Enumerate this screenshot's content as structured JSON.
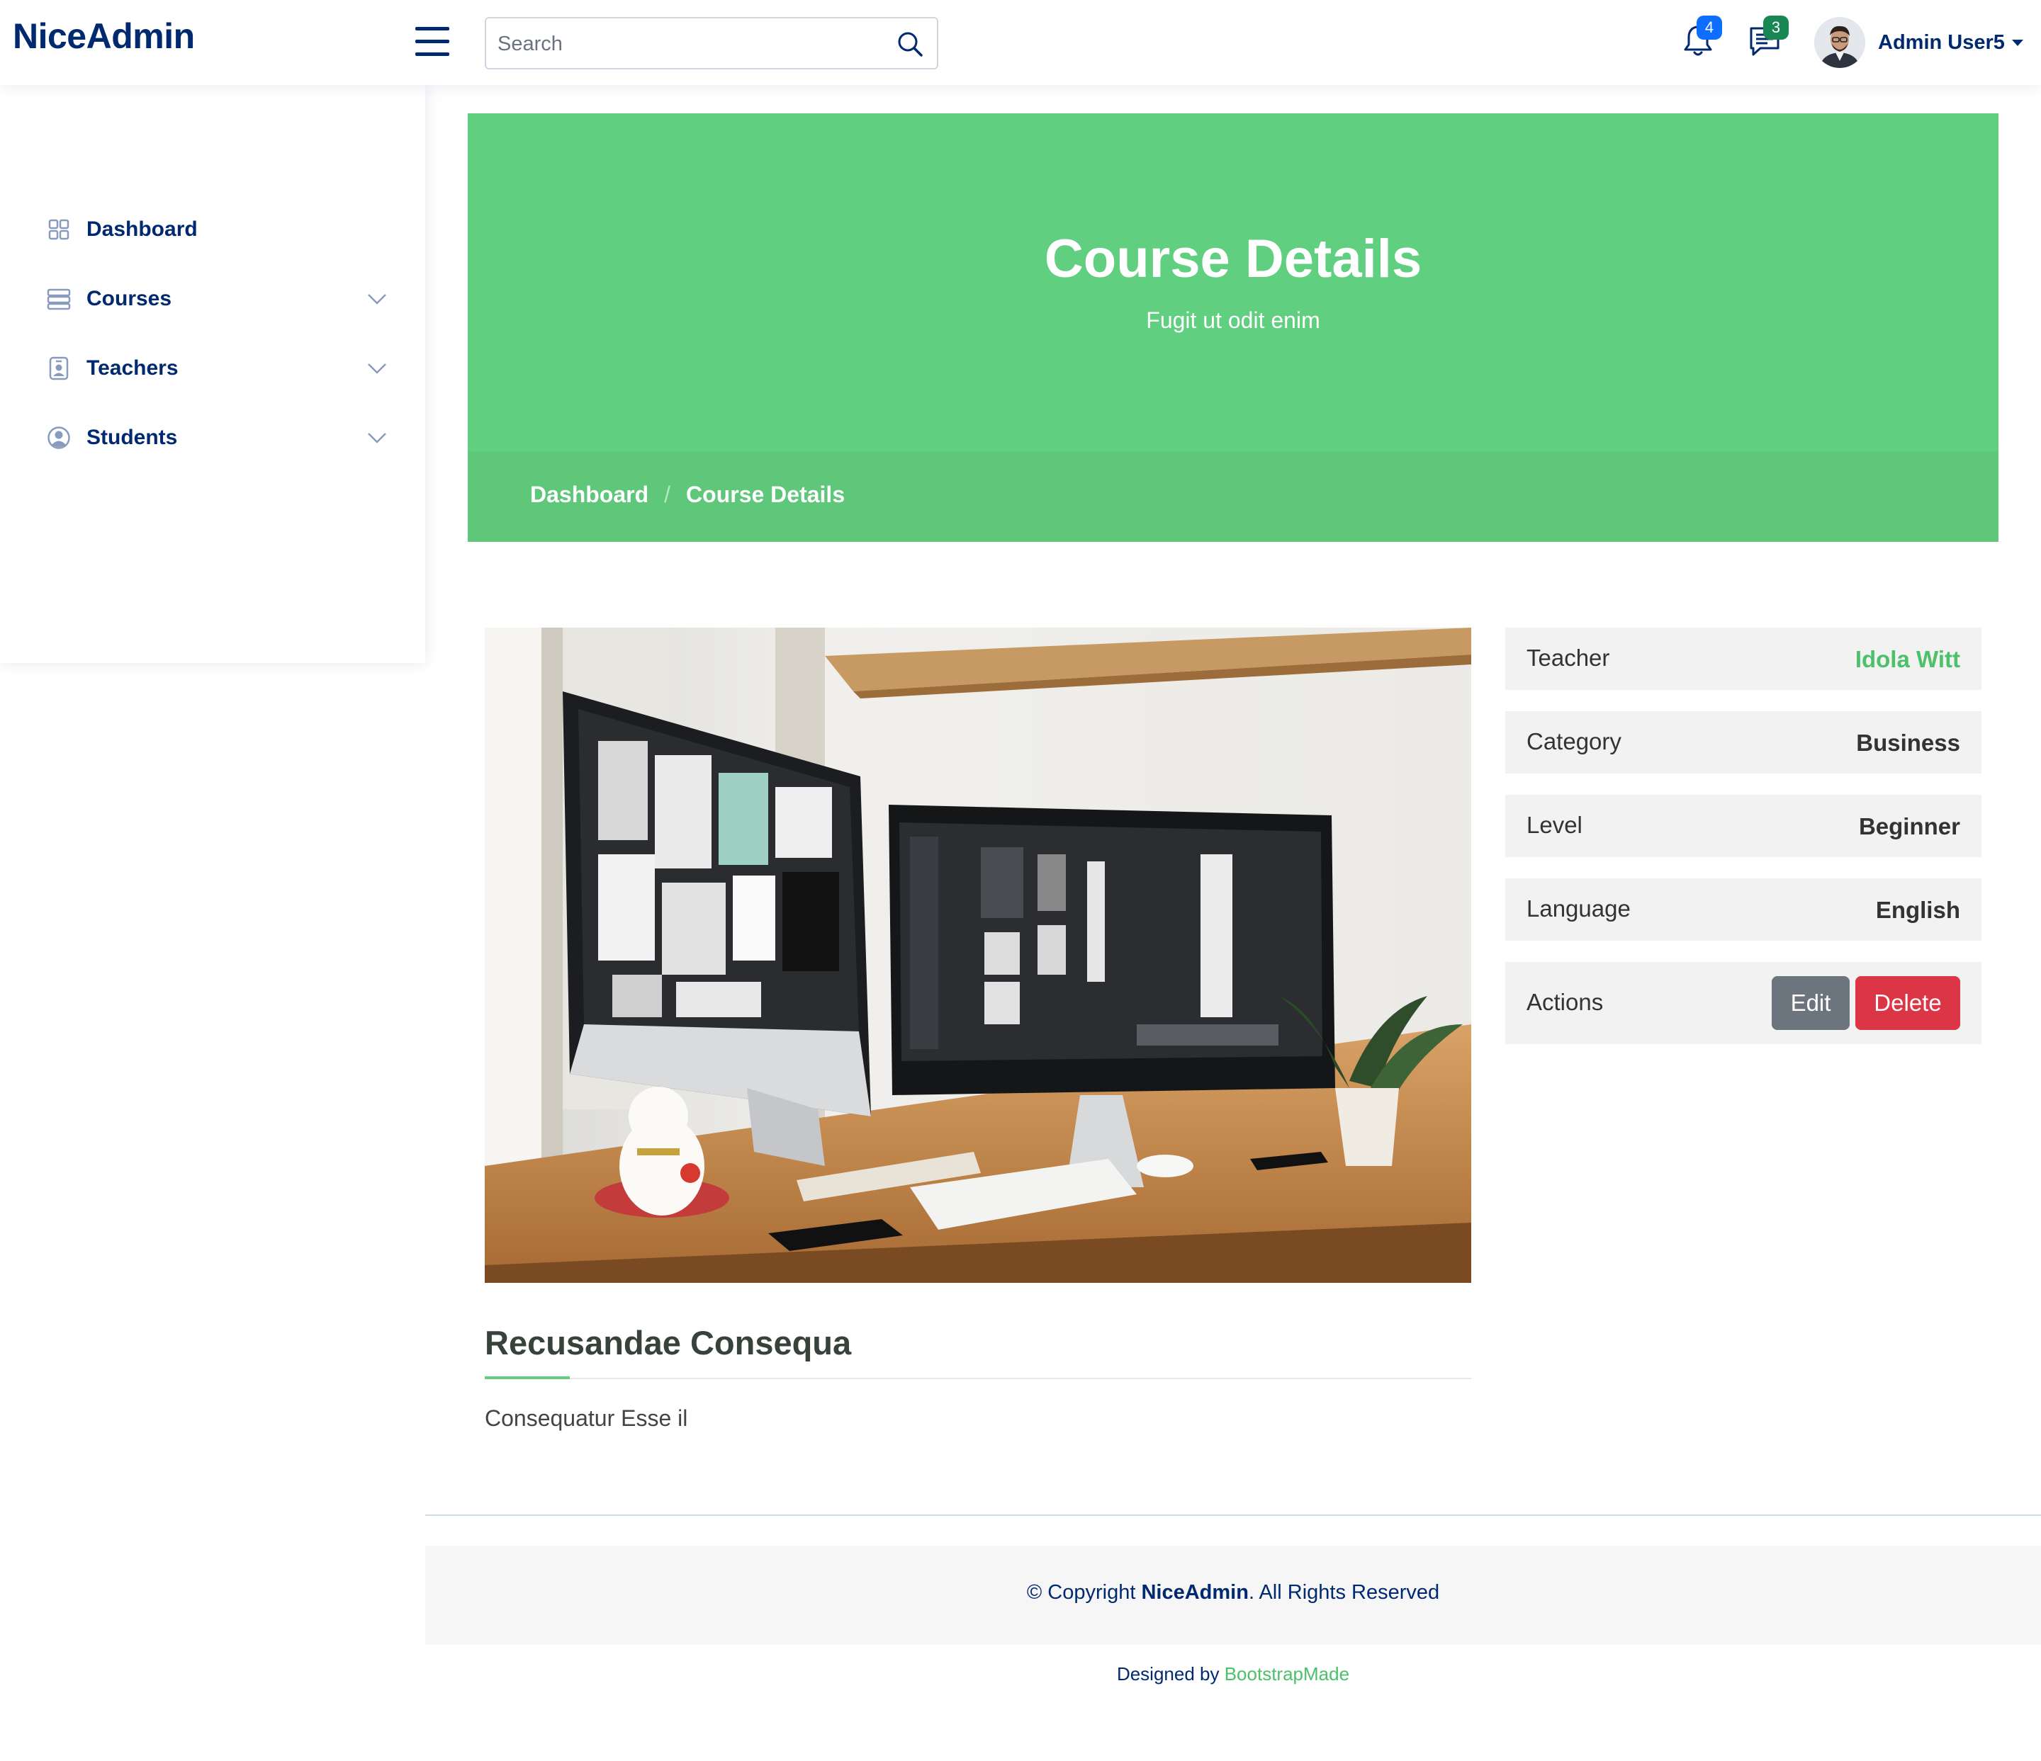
{
  "app": {
    "logo": "NiceAdmin"
  },
  "header": {
    "search_placeholder": "Search",
    "notifications_count": "4",
    "messages_count": "3",
    "user_name": "Admin User5"
  },
  "sidebar": {
    "items": [
      {
        "label": "Dashboard",
        "icon": "grid-icon",
        "expandable": false
      },
      {
        "label": "Courses",
        "icon": "layout-list-icon",
        "expandable": true
      },
      {
        "label": "Teachers",
        "icon": "person-badge-icon",
        "expandable": true
      },
      {
        "label": "Students",
        "icon": "person-circle-icon",
        "expandable": true
      }
    ]
  },
  "hero": {
    "title": "Course Details",
    "subtitle": "Fugit ut odit enim",
    "breadcrumb": [
      "Dashboard",
      "Course Details"
    ]
  },
  "course": {
    "image_alt": "workspace-with-two-monitors",
    "title": "Recusandae Consequa",
    "description": "Consequatur Esse il"
  },
  "details": {
    "teacher_label": "Teacher",
    "teacher_value": "Idola Witt",
    "category_label": "Category",
    "category_value": "Business",
    "level_label": "Level",
    "level_value": "Beginner",
    "language_label": "Language",
    "language_value": "English",
    "actions_label": "Actions",
    "edit_label": "Edit",
    "delete_label": "Delete"
  },
  "footer": {
    "copyright_prefix": "© Copyright",
    "copyright_brand": "NiceAdmin",
    "copyright_suffix": ". All Rights Reserved",
    "designed_by": "Designed by",
    "designer": "BootstrapMade"
  },
  "colors": {
    "brand": "#012970",
    "hero_green": "#61cf80",
    "accent_green": "#4cc06a",
    "badge_blue": "#0d6efd",
    "badge_green": "#198754",
    "edit_gray": "#6c757d",
    "delete_red": "#dc3545"
  }
}
